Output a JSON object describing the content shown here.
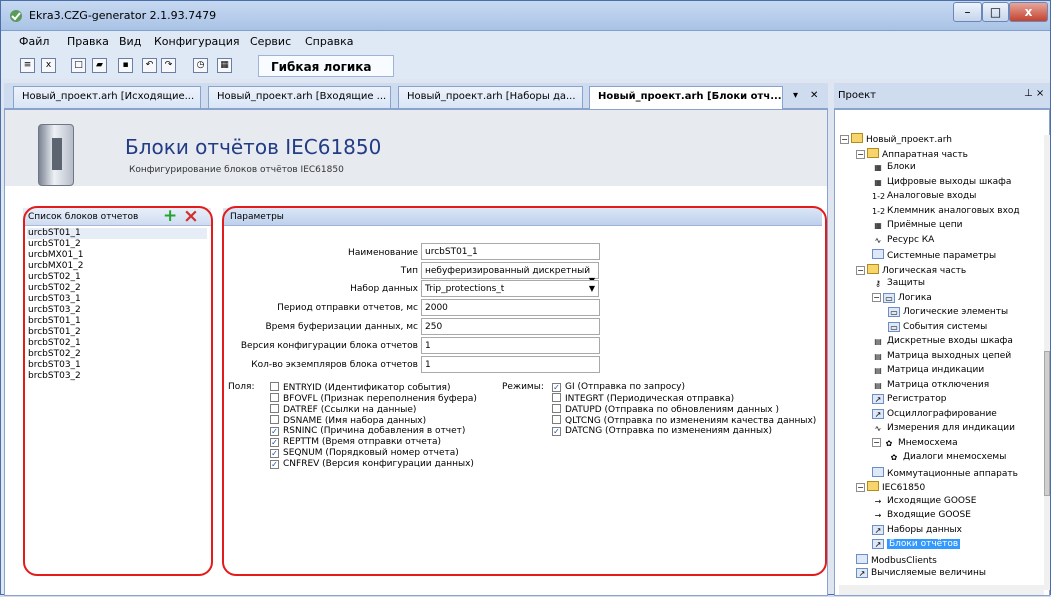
{
  "window": {
    "title": "Ekra3.CZG-generator 2.1.93.7479"
  },
  "menu": [
    "Файл",
    "Правка",
    "Вид",
    "Конфигурация",
    "Сервис",
    "Справка"
  ],
  "toolbar": {
    "tab_label": "Гибкая логика"
  },
  "tabs": [
    "Новый_проект.arh [Исходящие...",
    "Новый_проект.arh [Входящие ...",
    "Новый_проект.arh [Наборы да...",
    "Новый_проект.arh [Блоки отч..."
  ],
  "header": {
    "title": "Блоки отчётов IEC61850",
    "subtitle": "Конфигурирование блоков отчётов IEC61850"
  },
  "left_panel": {
    "title": "Список блоков отчетов",
    "items": [
      "urcbST01_1",
      "urcbST01_2",
      "urcbMX01_1",
      "urcbMX01_2",
      "urcbST02_1",
      "urcbST02_2",
      "urcbST03_1",
      "urcbST03_2",
      "brcbST01_1",
      "brcbST01_2",
      "brcbST02_1",
      "brcbST02_2",
      "brcbST03_1",
      "brcbST03_2"
    ]
  },
  "params": {
    "title": "Параметры",
    "name_label": "Наименование",
    "name_value": "urcbST01_1",
    "type_label": "Тип",
    "type_value": "небуферизированный дискретный",
    "dataset_label": "Набор данных",
    "dataset_value": "Trip_protections_t",
    "period_label": "Период отправки отчетов, мс",
    "period_value": "2000",
    "buffer_label": "Время буферизации данных, мс",
    "buffer_value": "250",
    "version_label": "Версия конфигурации блока отчетов",
    "version_value": "1",
    "instances_label": "Кол-во экземпляров блока отчетов",
    "instances_value": "1",
    "fields_label": "Поля:",
    "modes_label": "Режимы:",
    "fields": [
      {
        "label": "ENTRYID (Идентификатор события)",
        "checked": false
      },
      {
        "label": "BFOVFL (Признак переполнения буфера)",
        "checked": false
      },
      {
        "label": "DATREF (Ссылки на данные)",
        "checked": false
      },
      {
        "label": "DSNAME (Имя набора данных)",
        "checked": false
      },
      {
        "label": "RSNINC (Причина добавления в отчет)",
        "checked": true
      },
      {
        "label": "REPTTM (Время отправки отчета)",
        "checked": true
      },
      {
        "label": "SEQNUM (Порядковый номер отчета)",
        "checked": true
      },
      {
        "label": "CNFREV (Версия конфигурации данных)",
        "checked": true
      }
    ],
    "modes": [
      {
        "label": "GI (Отправка по запросу)",
        "checked": true
      },
      {
        "label": "INTEGRT (Периодическая отправка)",
        "checked": false
      },
      {
        "label": "DATUPD (Отправка по обновлениям данных )",
        "checked": false
      },
      {
        "label": "QLTCNG (Отправка по изменениям качества данных)",
        "checked": false
      },
      {
        "label": "DATCNG (Отправка по изменениям данных)",
        "checked": true
      }
    ]
  },
  "project_panel": {
    "title": "Проект",
    "pin": "⊥ ×"
  },
  "tree": [
    {
      "label": "Новый_проект.arh",
      "level": 0,
      "icon": "folder",
      "toggle": "−"
    },
    {
      "label": "Аппаратная часть",
      "level": 1,
      "icon": "folder",
      "toggle": "−"
    },
    {
      "label": "Блоки",
      "level": 2,
      "icon": "chip"
    },
    {
      "label": "Цифровые выходы шкафа",
      "level": 2,
      "icon": "chip"
    },
    {
      "label": "Аналоговые входы",
      "level": 2,
      "icon": "num"
    },
    {
      "label": "Клеммник аналоговых вход",
      "level": 2,
      "icon": "num"
    },
    {
      "label": "Приёмные цепи",
      "level": 2,
      "icon": "chip"
    },
    {
      "label": "Ресурс КА",
      "level": 2,
      "icon": "wave"
    },
    {
      "label": "Системные параметры",
      "level": 2,
      "icon": "doc"
    },
    {
      "label": "Логическая часть",
      "level": 1,
      "icon": "folder",
      "toggle": "−"
    },
    {
      "label": "Защиты",
      "level": 2,
      "icon": "key"
    },
    {
      "label": "Логика",
      "level": 2,
      "icon": "logic",
      "toggle": "−"
    },
    {
      "label": "Логические элементы",
      "level": 3,
      "icon": "logic"
    },
    {
      "label": "События системы",
      "level": 3,
      "icon": "logic"
    },
    {
      "label": "Дискретные входы шкафа",
      "level": 2,
      "icon": "grid"
    },
    {
      "label": "Матрица выходных цепей",
      "level": 2,
      "icon": "grid"
    },
    {
      "label": "Матрица индикации",
      "level": 2,
      "icon": "grid"
    },
    {
      "label": "Матрица отключения",
      "level": 2,
      "icon": "grid"
    },
    {
      "label": "Регистратор",
      "level": 2,
      "icon": "chart"
    },
    {
      "label": "Осциллографирование",
      "level": 2,
      "icon": "chart"
    },
    {
      "label": "Измерения для индикации",
      "level": 2,
      "icon": "wave"
    },
    {
      "label": "Мнемосхема",
      "level": 2,
      "icon": "plant",
      "toggle": "−"
    },
    {
      "label": "Диалоги мнемосхемы",
      "level": 3,
      "icon": "plant"
    },
    {
      "label": "Коммутационные аппарать",
      "level": 2,
      "icon": "doc"
    },
    {
      "label": "IEC61850",
      "level": 1,
      "icon": "folder",
      "toggle": "−"
    },
    {
      "label": "Исходящие GOOSE",
      "level": 2,
      "icon": "arrow"
    },
    {
      "label": "Входящие GOOSE",
      "level": 2,
      "icon": "arrow"
    },
    {
      "label": "Наборы данных",
      "level": 2,
      "icon": "chart"
    },
    {
      "label": "Блоки отчётов",
      "level": 2,
      "icon": "chart",
      "selected": true
    },
    {
      "label": "ModbusClients",
      "level": 1,
      "icon": "doc"
    },
    {
      "label": "Вычисляемые величины",
      "level": 1,
      "icon": "chart"
    }
  ]
}
